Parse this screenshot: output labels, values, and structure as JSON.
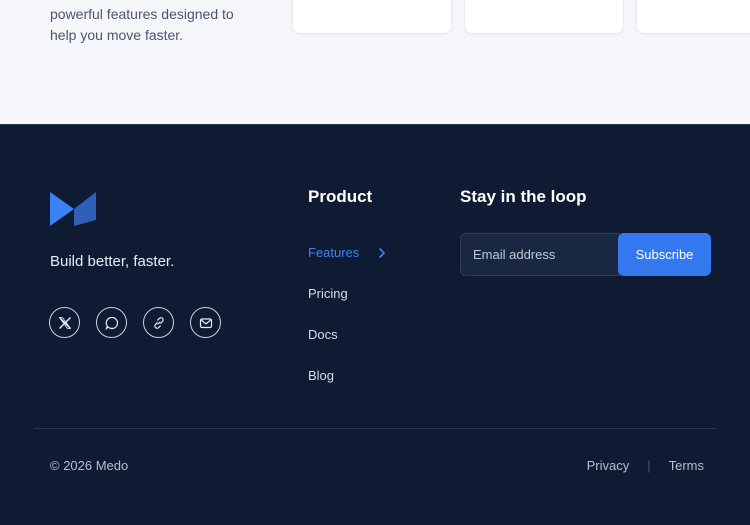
{
  "intro": {
    "line1": "powerful features designed to",
    "line2": "help you move faster."
  },
  "brand": {
    "logo_icon": "medo-logo-icon",
    "tagline": "Build better, faster."
  },
  "socials": [
    {
      "name": "x-icon"
    },
    {
      "name": "chat-icon"
    },
    {
      "name": "link-icon"
    },
    {
      "name": "mail-icon"
    }
  ],
  "product": {
    "title": "Product",
    "items": [
      {
        "label": "Features",
        "active": true
      },
      {
        "label": "Pricing"
      },
      {
        "label": "Docs"
      },
      {
        "label": "Blog"
      }
    ]
  },
  "newsletter": {
    "title": "Stay in the loop",
    "email_placeholder": "Email address",
    "button_label": "Subscribe"
  },
  "bottom": {
    "copyright": "© 2026 Medo",
    "privacy": "Privacy",
    "terms": "Terms"
  },
  "colors": {
    "footer_bg": "#0f1b33",
    "accent": "#3478f0",
    "active_link": "#3b82f6"
  }
}
